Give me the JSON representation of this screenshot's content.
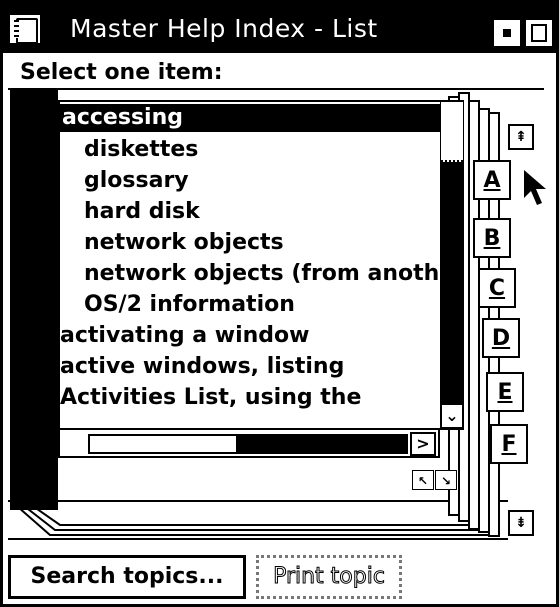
{
  "window": {
    "title": "Master Help Index - List"
  },
  "prompt": "Select one item:",
  "list": {
    "items": [
      {
        "text": "accessing",
        "indent": 0,
        "selected": true
      },
      {
        "text": "diskettes",
        "indent": 1,
        "selected": false
      },
      {
        "text": "glossary",
        "indent": 1,
        "selected": false
      },
      {
        "text": "hard disk",
        "indent": 1,
        "selected": false
      },
      {
        "text": "network objects",
        "indent": 1,
        "selected": false
      },
      {
        "text": "network objects (from anoth",
        "indent": 1,
        "selected": false
      },
      {
        "text": "OS/2 information",
        "indent": 1,
        "selected": false
      },
      {
        "text": "activating a window",
        "indent": 0,
        "selected": false
      },
      {
        "text": "active windows, listing",
        "indent": 0,
        "selected": false
      },
      {
        "text": "Activities List, using the",
        "indent": 0,
        "selected": false
      }
    ]
  },
  "tabs": [
    "A",
    "B",
    "C",
    "D",
    "E",
    "F"
  ],
  "buttons": {
    "search": "Search topics...",
    "print": "Print topic"
  },
  "icons": {
    "system_menu": "notebook-icon",
    "minimize": "minimize-icon",
    "maximize": "maximize-icon",
    "scroll_up": "double-up-arrow-icon",
    "scroll_down": "double-down-arrow-icon",
    "cursor": "mouse-pointer-icon"
  }
}
